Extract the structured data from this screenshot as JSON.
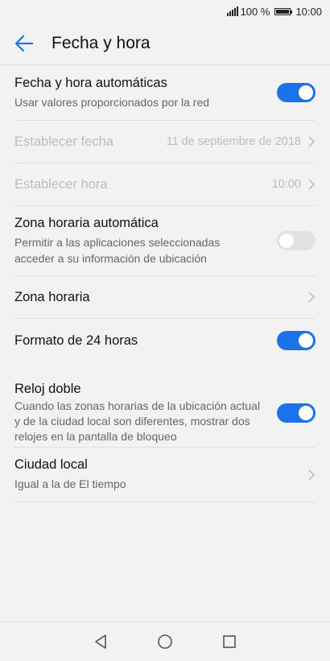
{
  "status_bar": {
    "battery_percent": "100 %",
    "time": "10:00"
  },
  "header": {
    "title": "Fecha y hora"
  },
  "settings": {
    "auto_datetime": {
      "label": "Fecha y hora automáticas",
      "sub": "Usar valores proporcionados por la red",
      "enabled": true
    },
    "set_date": {
      "label": "Establecer fecha",
      "value": "11 de septiembre de 2018"
    },
    "set_time": {
      "label": "Establecer hora",
      "value": "10:00"
    },
    "auto_timezone": {
      "label": "Zona horaria automática",
      "sub": "Permitir a las aplicaciones seleccionadas acceder a su información de ubicación",
      "enabled": false
    },
    "timezone": {
      "label": "Zona horaria"
    },
    "format_24h": {
      "label": "Formato de 24 horas",
      "enabled": true
    },
    "dual_clock": {
      "label": "Reloj doble",
      "sub": "Cuando las zonas horarias de la ubicación actual y de la ciudad local son diferentes, mostrar dos relojes en la pantalla de bloqueo",
      "enabled": true
    },
    "home_city": {
      "label": "Ciudad local",
      "sub": "Igual a la de El tiempo"
    }
  },
  "colors": {
    "accent": "#1a73e8",
    "disabled_text": "#bdbdbd",
    "toggle_off": "#e1e1e1"
  },
  "icons": {
    "back": "arrow-left-icon",
    "chevron": "chevron-right-icon",
    "nav_back": "triangle-back-icon",
    "nav_home": "circle-home-icon",
    "nav_recent": "square-recent-icon"
  }
}
